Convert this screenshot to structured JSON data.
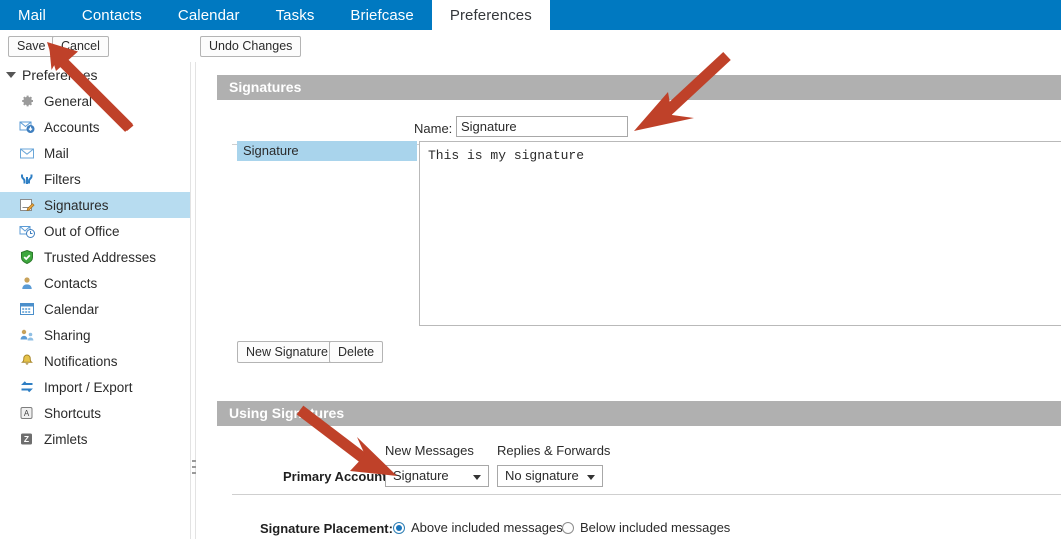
{
  "nav": {
    "tabs": [
      {
        "label": "Mail",
        "active": false
      },
      {
        "label": "Contacts",
        "active": false
      },
      {
        "label": "Calendar",
        "active": false
      },
      {
        "label": "Tasks",
        "active": false
      },
      {
        "label": "Briefcase",
        "active": false
      },
      {
        "label": "Preferences",
        "active": true
      }
    ],
    "bar_color": "#0079c1"
  },
  "toolbar": {
    "save_label": "Save",
    "cancel_label": "Cancel",
    "undo_label": "Undo Changes"
  },
  "sidebar": {
    "root_label": "Preferences",
    "items": [
      {
        "label": "General",
        "icon": "gear-icon",
        "selected": false
      },
      {
        "label": "Accounts",
        "icon": "accounts-icon",
        "selected": false
      },
      {
        "label": "Mail",
        "icon": "envelope-icon",
        "selected": false
      },
      {
        "label": "Filters",
        "icon": "filters-icon",
        "selected": false
      },
      {
        "label": "Signatures",
        "icon": "signature-icon",
        "selected": true
      },
      {
        "label": "Out of Office",
        "icon": "out-of-office-icon",
        "selected": false
      },
      {
        "label": "Trusted Addresses",
        "icon": "shield-icon",
        "selected": false
      },
      {
        "label": "Contacts",
        "icon": "contact-icon",
        "selected": false
      },
      {
        "label": "Calendar",
        "icon": "calendar-icon",
        "selected": false
      },
      {
        "label": "Sharing",
        "icon": "sharing-icon",
        "selected": false
      },
      {
        "label": "Notifications",
        "icon": "bell-icon",
        "selected": false
      },
      {
        "label": "Import / Export",
        "icon": "import-export-icon",
        "selected": false
      },
      {
        "label": "Shortcuts",
        "icon": "keyboard-key-icon",
        "selected": false
      },
      {
        "label": "Zimlets",
        "icon": "zimlets-icon",
        "selected": false
      }
    ],
    "selected_highlight_color": "#b7dcf0"
  },
  "signatures_section": {
    "header": "Signatures",
    "name_label": "Name:",
    "name_value": "Signature",
    "name_placeholder": "",
    "list": [
      {
        "label": "Signature",
        "selected": true
      }
    ],
    "body_text": "This is my signature",
    "body_placeholder": "",
    "new_signature_label": "New Signature",
    "delete_label": "Delete"
  },
  "using_section": {
    "header": "Using Signatures",
    "col_new_messages": "New Messages",
    "col_replies_forwards": "Replies & Forwards",
    "primary_account_label": "Primary Account:",
    "new_messages_value": "Signature",
    "replies_value": "No signature",
    "placement_label": "Signature Placement:",
    "placement_above": "Above included messages",
    "placement_below": "Below included messages",
    "placement_selected": "above"
  },
  "annotations": {
    "arrow_color": "#bf4129",
    "arrows": [
      {
        "name": "arrow-to-save-button",
        "points_to": "Save"
      },
      {
        "name": "arrow-to-name-field",
        "points_to": "Name"
      },
      {
        "name": "arrow-to-new-messages-dropdown",
        "points_to": "Primary Account New Messages"
      }
    ]
  }
}
